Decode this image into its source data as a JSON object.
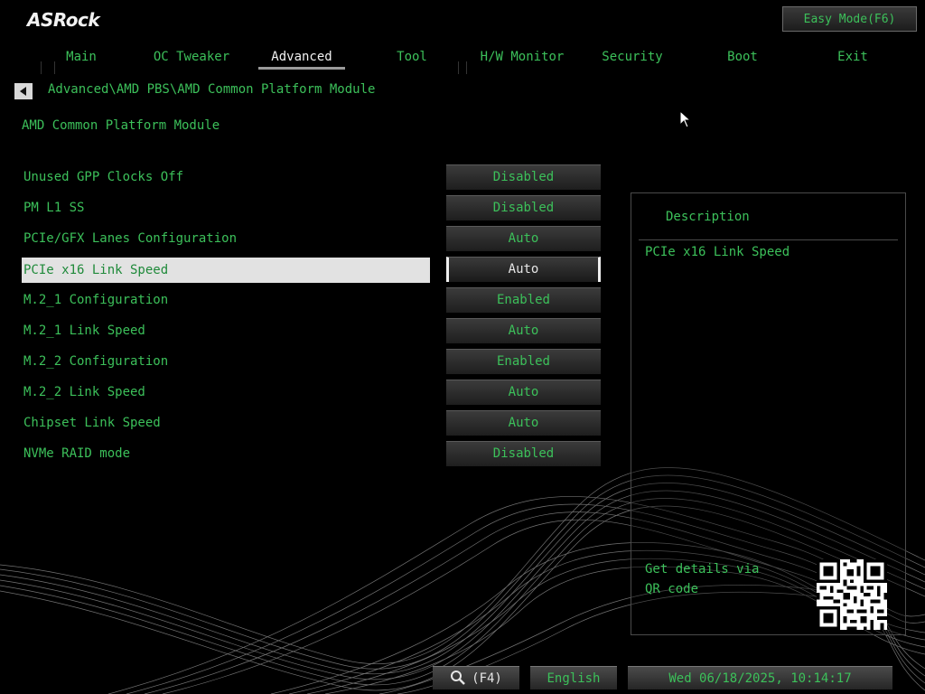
{
  "logo": "ASRock",
  "easy_mode_label": "Easy Mode(F6)",
  "tabs": [
    {
      "label": "Main"
    },
    {
      "label": "OC Tweaker"
    },
    {
      "label": "Advanced"
    },
    {
      "label": "Tool"
    },
    {
      "label": "H/W Monitor"
    },
    {
      "label": "Security"
    },
    {
      "label": "Boot"
    },
    {
      "label": "Exit"
    }
  ],
  "active_tab": "Advanced",
  "breadcrumb": "Advanced\\AMD PBS\\AMD Common Platform Module",
  "page_title": "AMD Common Platform Module",
  "settings": [
    {
      "label": "Unused GPP Clocks Off",
      "value": "Disabled"
    },
    {
      "label": "PM L1 SS",
      "value": "Disabled"
    },
    {
      "label": "PCIe/GFX Lanes Configuration",
      "value": "Auto"
    },
    {
      "label": "PCIe x16 Link Speed",
      "value": "Auto"
    },
    {
      "label": "M.2_1 Configuration",
      "value": "Enabled"
    },
    {
      "label": "M.2_1 Link Speed",
      "value": "Auto"
    },
    {
      "label": "M.2_2 Configuration",
      "value": "Enabled"
    },
    {
      "label": "M.2_2 Link Speed",
      "value": "Auto"
    },
    {
      "label": "Chipset Link Speed",
      "value": "Auto"
    },
    {
      "label": "NVMe RAID mode",
      "value": "Disabled"
    }
  ],
  "selected_setting": "PCIe x16 Link Speed",
  "description": {
    "title": "Description",
    "text": "PCIe x16 Link Speed",
    "qr_text": "Get details via QR code"
  },
  "bottom": {
    "search_label": "(F4)",
    "language": "English",
    "datetime": "Wed 06/18/2025, 10:14:17"
  },
  "colors": {
    "accent_green": "#3cc05a",
    "selected_row_bg": "#e2e2e2",
    "background": "#000000"
  }
}
